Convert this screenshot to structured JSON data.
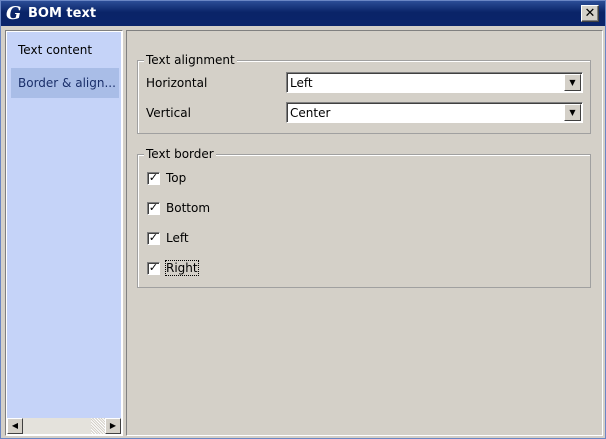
{
  "window": {
    "title": "BOM text",
    "app_icon_glyph": "G",
    "close_glyph": "✕"
  },
  "sidebar": {
    "items": [
      {
        "label": "Text content",
        "selected": false
      },
      {
        "label": "Border & align...",
        "selected": true
      }
    ],
    "scroll_left_glyph": "◀",
    "scroll_right_glyph": "▶"
  },
  "text_alignment": {
    "legend": "Text alignment",
    "horizontal_label": "Horizontal",
    "horizontal_value": "Left",
    "vertical_label": "Vertical",
    "vertical_value": "Center",
    "dropdown_glyph": "▼"
  },
  "text_border": {
    "legend": "Text border",
    "options": [
      {
        "label": "Top",
        "checked": true
      },
      {
        "label": "Bottom",
        "checked": true
      },
      {
        "label": "Left",
        "checked": true
      },
      {
        "label": "Right",
        "checked": true
      }
    ],
    "check_glyph": "✓"
  },
  "colors": {
    "titlebar": "#0a246a",
    "sidebar_bg": "#c5d3f8",
    "sidebar_selected": "#a9bde7",
    "dialog_bg": "#d4d0c8"
  }
}
